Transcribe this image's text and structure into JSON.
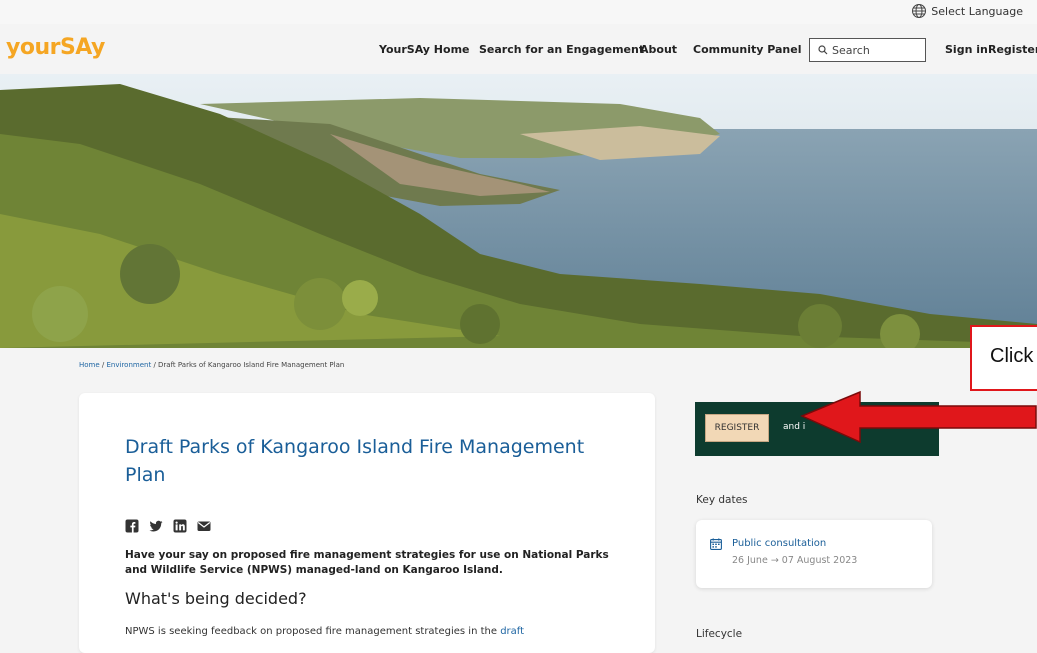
{
  "topbar": {
    "language_label": "Select Language",
    "language_icon": "globe-icon"
  },
  "header": {
    "logo": "yourSAy",
    "nav": [
      "YourSAy Home",
      "Search for an Engagement",
      "About",
      "Community Panel"
    ],
    "search_placeholder": "Search",
    "sign_in": "Sign in",
    "register": "Register"
  },
  "breadcrumb": {
    "home": "Home",
    "sep1": "/",
    "environment": "Environment",
    "sep2": "/",
    "current": "Draft Parks of Kangaroo Island Fire Management Plan"
  },
  "main": {
    "title": "Draft Parks of Kangaroo Island Fire Management Plan",
    "social_icons": [
      "facebook-icon",
      "twitter-icon",
      "linkedin-icon",
      "email-icon"
    ],
    "lead": "Have your say on proposed fire management strategies for use on National Parks and Wildlife Service (NPWS) managed-land on Kangaroo Island.",
    "section_heading": "What's being decided?",
    "body_text": "NPWS is seeking feedback on proposed fire management strategies in the",
    "body_link": "draft"
  },
  "sidebar": {
    "register_button": "REGISTER",
    "register_text": "and i",
    "key_dates_title": "Key dates",
    "key_date": {
      "name": "Public consultation",
      "range": "26 June → 07 August 2023"
    },
    "lifecycle_title": "Lifecycle"
  },
  "annotation": {
    "callout_text": "Click",
    "accent_color": "#e0171b"
  }
}
